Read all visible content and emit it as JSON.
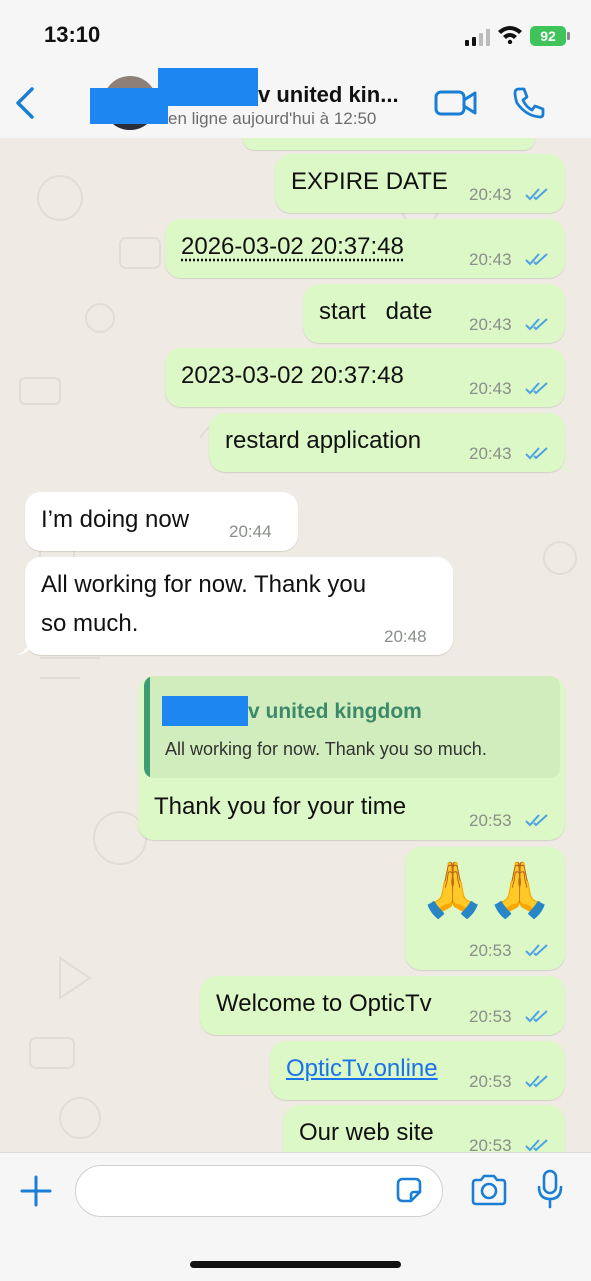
{
  "status_bar": {
    "time": "13:10",
    "battery": "92"
  },
  "header": {
    "name": "v united kin...",
    "status": "en ligne aujourd'hui à 12:50"
  },
  "messages": {
    "m1": {
      "text": "EXPIRE DATE",
      "time": "20:43"
    },
    "m2": {
      "text": "2026-03-02 20:37:48",
      "time": "20:43"
    },
    "m3": {
      "text": "start   date",
      "time": "20:43"
    },
    "m4": {
      "text": "2023-03-02 20:37:48",
      "time": "20:43"
    },
    "m5": {
      "text": "restard application",
      "time": "20:43"
    },
    "m6": {
      "text": "I’m doing now",
      "time": "20:44"
    },
    "m7": {
      "line1": "All working for now. Thank you",
      "line2": "so much.",
      "time": "20:48"
    },
    "m8": {
      "quote_name": "v united kingdom",
      "quote_text": "All working for now. Thank you so much.",
      "text": "Thank you for your time",
      "time": "20:53"
    },
    "m9": {
      "emoji": "🙏🙏",
      "time": "20:53"
    },
    "m10": {
      "text": "Welcome to OpticTv",
      "time": "20:53"
    },
    "m11": {
      "text": "OpticTv.online",
      "time": "20:53"
    },
    "m12": {
      "text": "Our web site",
      "time": "20:53"
    }
  },
  "colors": {
    "outgoing_bubble": "#dcf8c6",
    "incoming_bubble": "#ffffff",
    "accent_blue": "#1a73e8",
    "read_ticks": "#4fa3e3",
    "quote_accent": "#3e9b74"
  },
  "icons": [
    "back-chevron-icon",
    "video-call-icon",
    "phone-icon",
    "plus-icon",
    "sticker-icon",
    "camera-icon",
    "microphone-icon"
  ]
}
